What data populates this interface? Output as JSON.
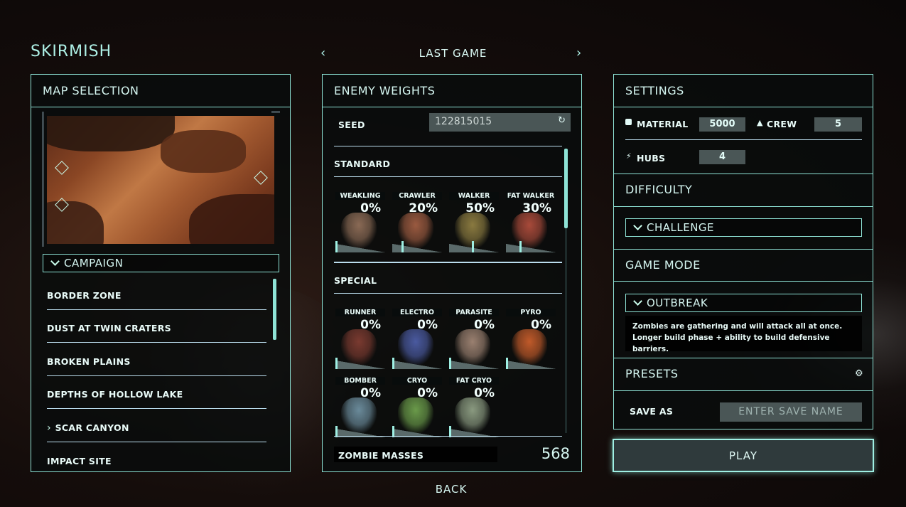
{
  "header": {
    "title": "SKIRMISH",
    "center_label": "LAST GAME",
    "prev_icon": "chevron-left-icon",
    "next_icon": "chevron-right-icon"
  },
  "map_panel": {
    "title": "MAP SELECTION",
    "category": "CAMPAIGN",
    "maps": [
      {
        "label": "BORDER ZONE"
      },
      {
        "label": "DUST AT TWIN CRATERS"
      },
      {
        "label": "BROKEN PLAINS"
      },
      {
        "label": "DEPTHS OF HOLLOW LAKE"
      },
      {
        "label": "SCAR CANYON"
      },
      {
        "label": "IMPACT SITE"
      }
    ]
  },
  "enemy_panel": {
    "title": "ENEMY WEIGHTS",
    "seed_label": "SEED",
    "seed_value": "122815015",
    "sections": {
      "standard": {
        "label": "STANDARD",
        "enemies": [
          {
            "name": "WEAKLING",
            "pct": "0%",
            "value": 0.0,
            "color": "#8a6a55"
          },
          {
            "name": "CRAWLER",
            "pct": "20%",
            "value": 0.2,
            "color": "#9a5a40"
          },
          {
            "name": "WALKER",
            "pct": "50%",
            "value": 0.5,
            "color": "#8a7a40"
          },
          {
            "name": "FAT WALKER",
            "pct": "30%",
            "value": 0.3,
            "color": "#a84a3a"
          }
        ]
      },
      "special": {
        "label": "SPECIAL",
        "enemies": [
          {
            "name": "RUNNER",
            "pct": "0%",
            "value": 0.0,
            "color": "#7a3a30"
          },
          {
            "name": "ELECTRO",
            "pct": "0%",
            "value": 0.0,
            "color": "#4a5aa0"
          },
          {
            "name": "PARASITE",
            "pct": "0%",
            "value": 0.0,
            "color": "#9a8070"
          },
          {
            "name": "PYRO",
            "pct": "0%",
            "value": 0.0,
            "color": "#c05a2a"
          },
          {
            "name": "BOMBER",
            "pct": "0%",
            "value": 0.0,
            "color": "#6a8a9a"
          },
          {
            "name": "CRYO",
            "pct": "0%",
            "value": 0.0,
            "color": "#6a9a4a"
          },
          {
            "name": "FAT CRYO",
            "pct": "0%",
            "value": 0.0,
            "color": "#8a9a80"
          }
        ]
      }
    },
    "masses_label": "ZOMBIE MASSES",
    "masses_value": "568"
  },
  "settings_panel": {
    "title": "SETTINGS",
    "material_label": "MATERIAL",
    "material_value": "5000",
    "crew_label": "CREW",
    "crew_value": "5",
    "hubs_label": "HUBS",
    "hubs_value": "4",
    "difficulty_title": "DIFFICULTY",
    "difficulty_value": "CHALLENGE",
    "game_mode_title": "GAME MODE",
    "game_mode_value": "OUTBREAK",
    "game_mode_desc": "Zombies are gathering and will attack all at once. Longer build phase + ability to build defensive barriers.",
    "presets_title": "PRESETS",
    "save_as_label": "SAVE AS",
    "save_placeholder": "ENTER SAVE NAME"
  },
  "play_label": "PLAY",
  "back_label": "BACK",
  "colors": {
    "accent": "#8ee3d6",
    "panel_bg": "#080c0c",
    "field_bg": "#4a5656"
  }
}
